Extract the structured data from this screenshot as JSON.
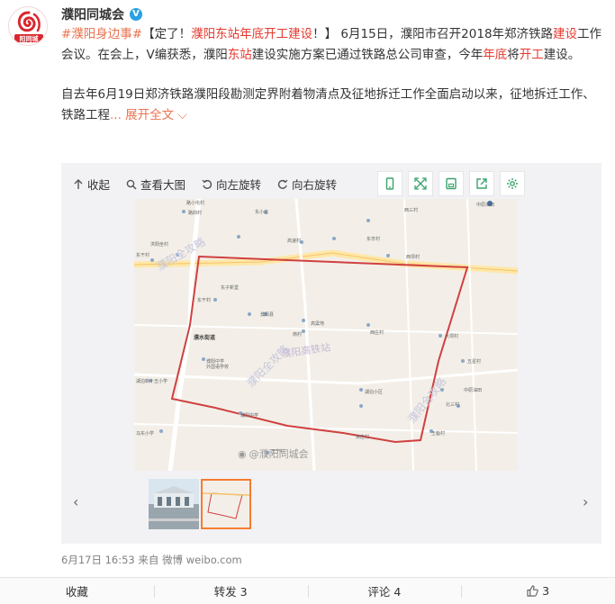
{
  "author": {
    "name": "濮阳同城会",
    "avatar_text": "阳同城",
    "verified_mark": "V"
  },
  "post": {
    "topic": "#濮阳身边事#",
    "headline_open": "【定了！",
    "headline_link": "濮阳东站年底开工建设",
    "headline_close": "！】",
    "line1_a": " 6月15日，濮阳市召开2018年郑济铁路",
    "hl_jianshe": "建设",
    "line1_b": "工作会议。在会上，V编获悉，濮阳",
    "hl_dongzhan": "东站",
    "line1_c": "建设实施方案已通过铁路总公司审查，今年",
    "hl_niandi": "年底",
    "line1_d": "将",
    "hl_kaigong": "开工",
    "line1_e": "建设。",
    "para2": "自去年6月19日郑济铁路濮阳段勘测定界附着物清点及征地拆迁工作全面启动以来，征地拆迁工作、铁路工程",
    "expand": "... 展开全文"
  },
  "media": {
    "toolbar": {
      "collapse": "收起",
      "view_large": "查看大图",
      "rotate_left": "向左旋转",
      "rotate_right": "向右旋转"
    },
    "map": {
      "title_watermark": "濮阳高铁站",
      "wm_left": "濮阳全攻略",
      "wm_right": "濮阳全攻略",
      "labels": [
        "路小屯村",
        "路四村",
        "东小屯",
        "石炉",
        "西三村",
        "洪阳坐村",
        "高速村",
        "东辛村",
        "东子村",
        "濮阳县",
        "东屯村",
        "濮阳中学",
        "东子新堂",
        "濮水街道",
        "濮阳中学外国语学校",
        "高粱地",
        "黄庄村",
        "王宁村",
        "王砦村",
        "胡庄村",
        "南王村",
        "南村",
        "中原油田",
        "马东小学",
        "西庄村",
        "湖泊小区",
        "新安村",
        "五星村",
        "北三村"
      ]
    },
    "watermark": "@濮阳同城会"
  },
  "meta": {
    "time": "6月17日 16:53",
    "via": "来自",
    "source": "微博 weibo.com"
  },
  "footer": {
    "collect": "收藏",
    "forward": "转发 3",
    "comment": "评论 4",
    "like": "3"
  }
}
